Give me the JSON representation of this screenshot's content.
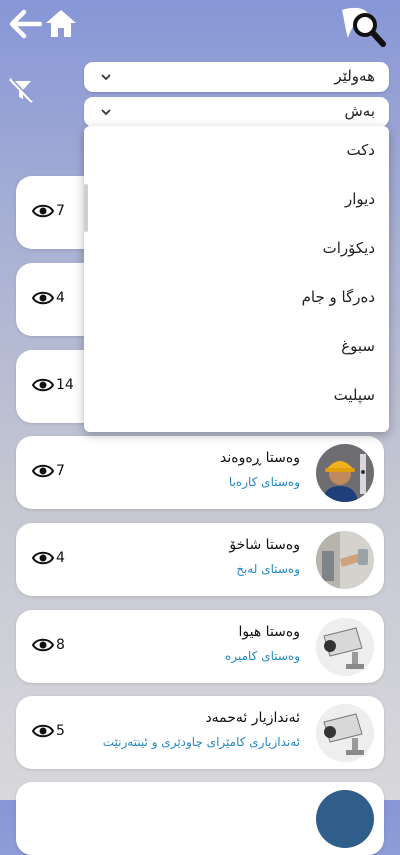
{
  "filters": {
    "city_value": "هەولێر",
    "section_value": "بەش",
    "section_options": [
      "دکت",
      "دیوار",
      "دیکۆرات",
      "دەرگا و جام",
      "سبوغ",
      "سپلیت"
    ]
  },
  "cards": [
    {
      "views": "7",
      "name": "",
      "job": ""
    },
    {
      "views": "4",
      "name": "",
      "job": ""
    },
    {
      "views": "14",
      "name": "",
      "job": ""
    },
    {
      "views": "7",
      "name": "وەستا ڕەوەند",
      "job": "وەستای کارەبا",
      "avatar_icon": "electrician-avatar"
    },
    {
      "views": "4",
      "name": "وەستا شاخۆ",
      "job": "وەستای لەبخ",
      "avatar_icon": "plasterer-avatar"
    },
    {
      "views": "8",
      "name": "وەستا هیوا",
      "job": "وەستای کامیرە",
      "avatar_icon": "camera-avatar"
    },
    {
      "views": "5",
      "name": "ئەندازیار ئەحمەد",
      "job": "ئەندازیاری کامێرای چاودێری و ئینتەرنێت",
      "avatar_icon": "camera-avatar"
    }
  ],
  "colors": {
    "link": "#2487c8",
    "bg_top": "#8796d6"
  }
}
